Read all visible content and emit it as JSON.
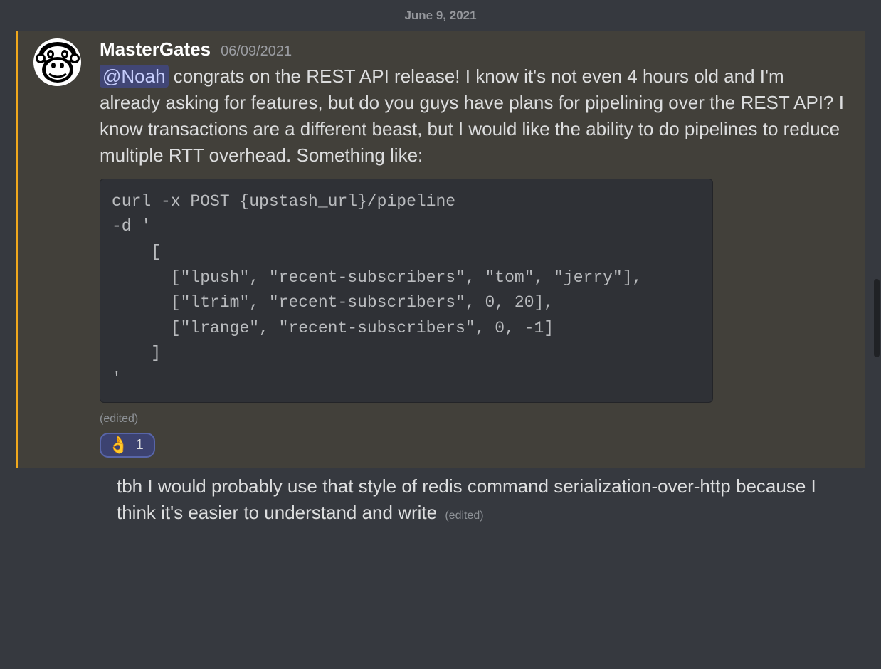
{
  "divider": {
    "label": "June 9, 2021"
  },
  "message": {
    "username": "MasterGates",
    "timestamp": "06/09/2021",
    "mention": "@Noah",
    "text_after_mention": " congrats on the REST API release! I know it's not even 4 hours old and I'm already asking for features, but do you guys have plans for pipelining over the REST API? I know transactions are a different beast, but I would like the ability to do pipelines to reduce multiple RTT overhead. Something like:",
    "code": "curl -x POST {upstash_url}/pipeline\n-d '\n    [\n      [\"lpush\", \"recent-subscribers\", \"tom\", \"jerry\"],\n      [\"ltrim\", \"recent-subscribers\", 0, 20],\n      [\"lrange\", \"recent-subscribers\", 0, -1]\n    ]\n'",
    "edited": "(edited)",
    "reaction": {
      "emoji": "👌",
      "count": "1"
    }
  },
  "followup": {
    "text": "tbh I would probably use that style of redis command serialization-over-http because I think it's easier to understand and write",
    "edited": "(edited)"
  }
}
